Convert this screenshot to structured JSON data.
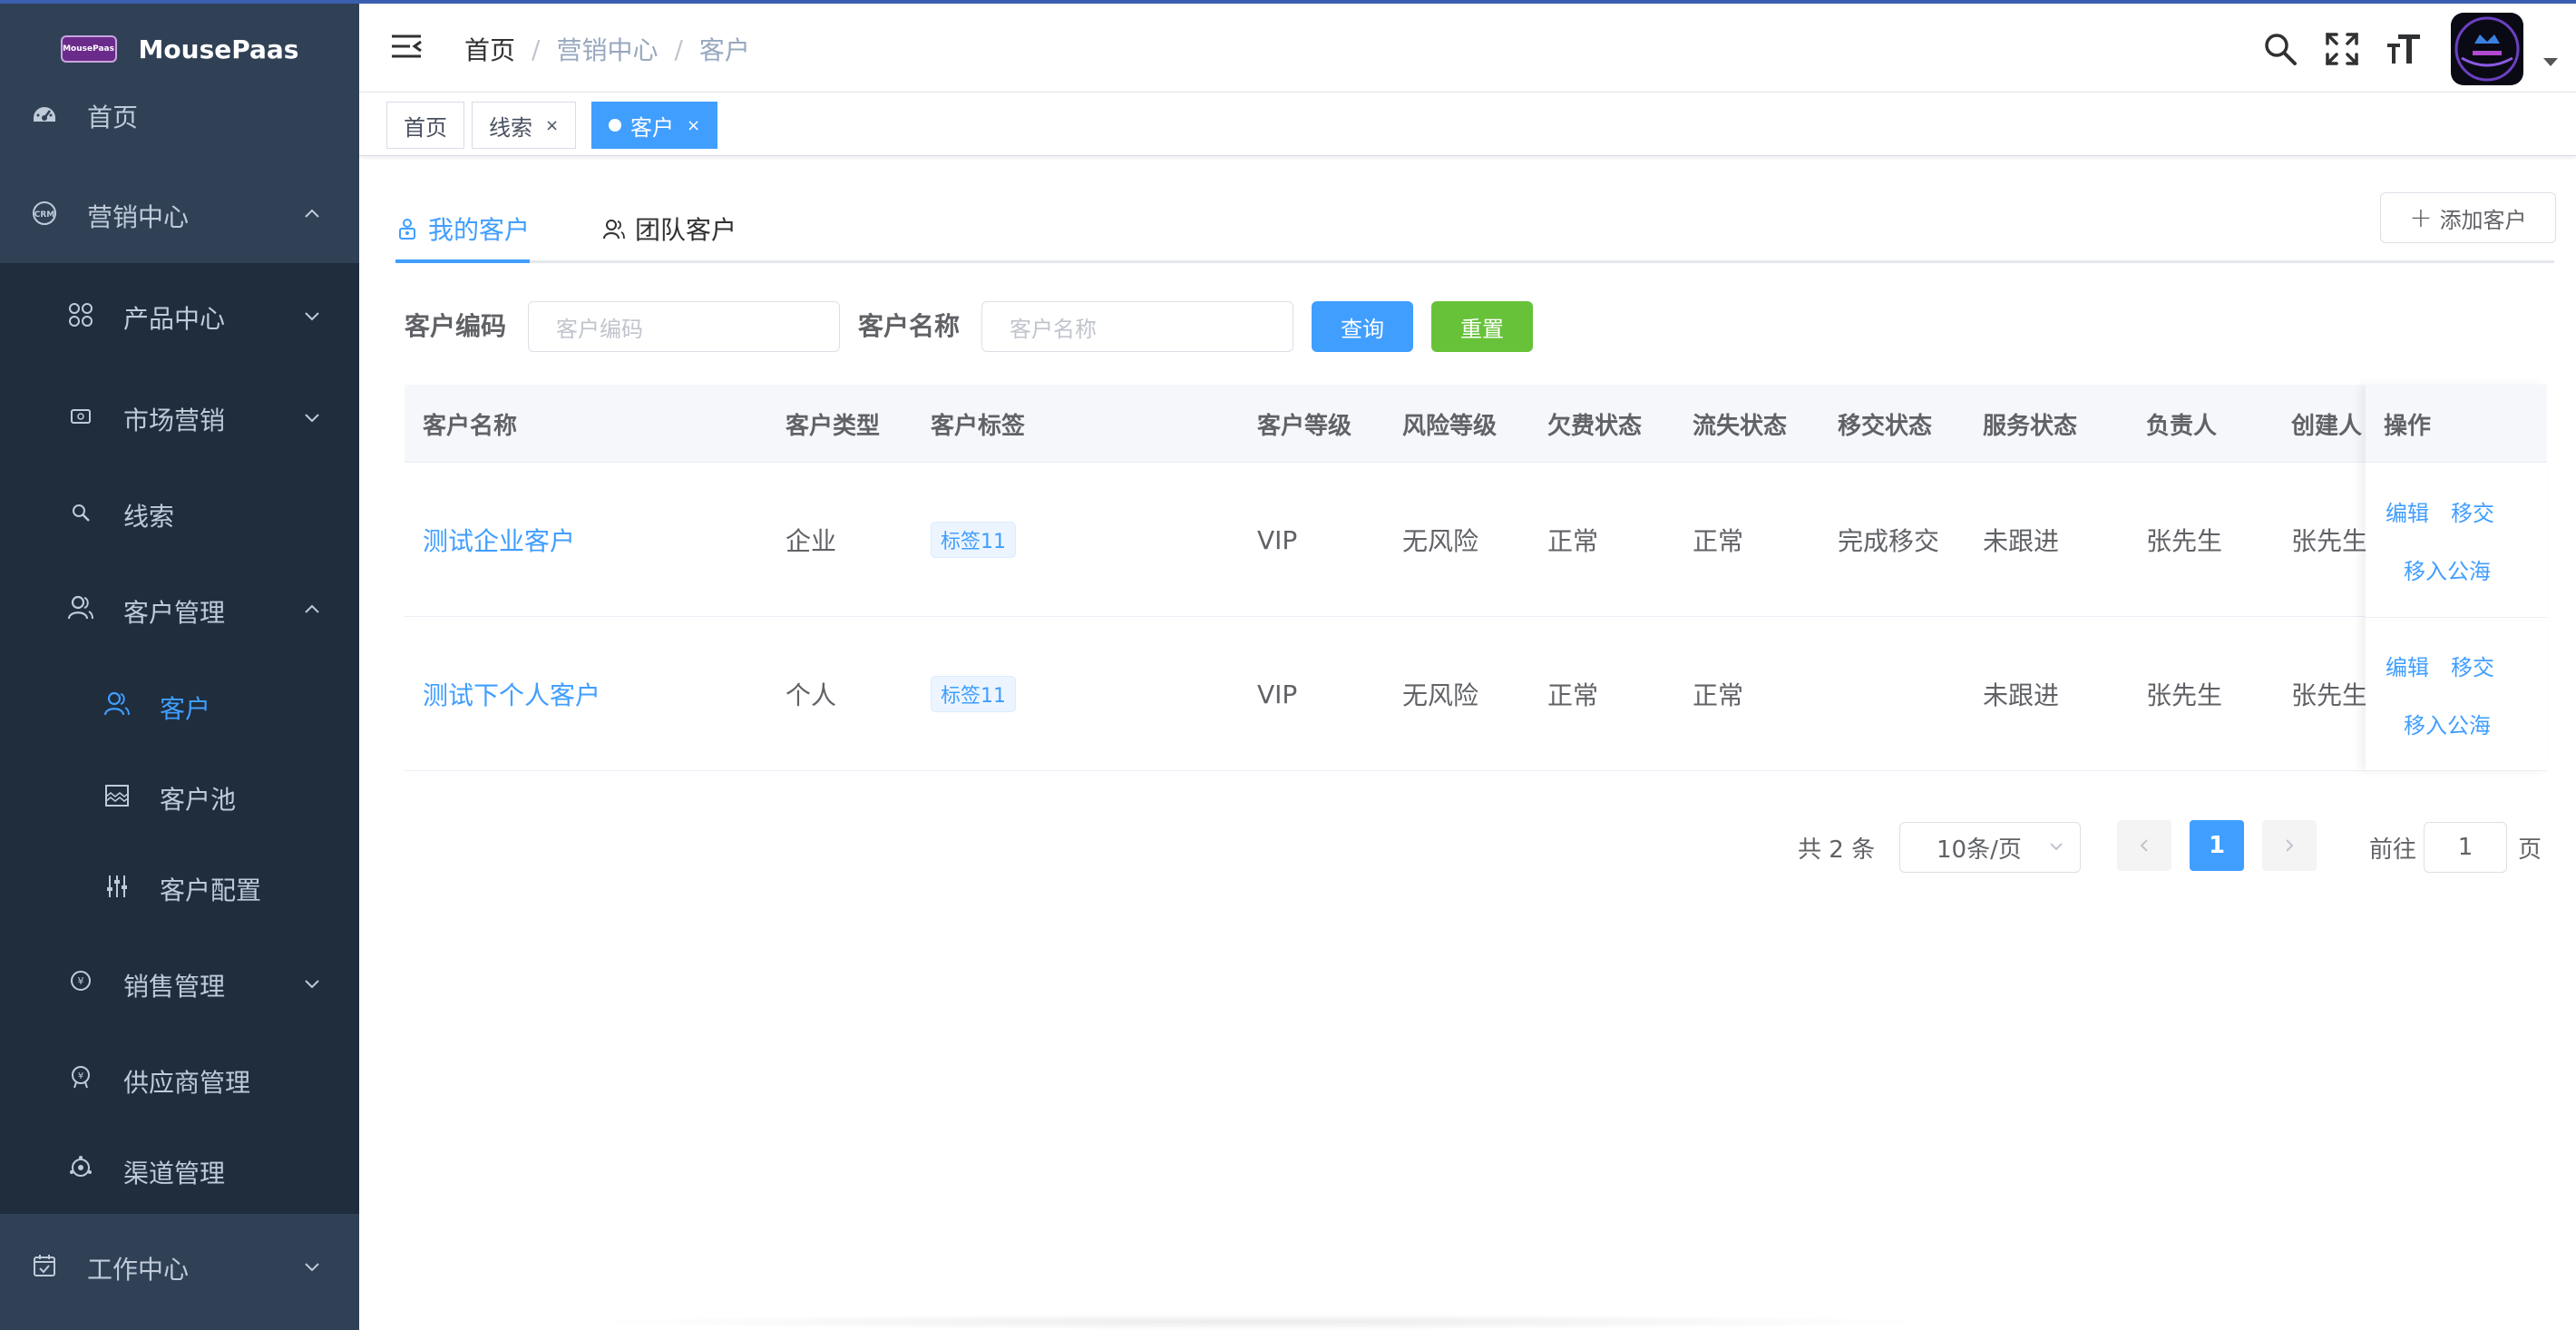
{
  "app": {
    "logo_text": "MousePaas",
    "logo_badge": "MousePaas"
  },
  "sidebar": {
    "items": [
      {
        "label": "首页",
        "icon": "dashboard-icon"
      },
      {
        "label": "营销中心",
        "icon": "crm-icon",
        "expanded": true
      },
      {
        "label": "产品中心",
        "icon": "product-grid-icon"
      },
      {
        "label": "市场营销",
        "icon": "marketing-icon"
      },
      {
        "label": "线索",
        "icon": "clue-search-icon"
      },
      {
        "label": "客户管理",
        "icon": "user-icon",
        "expanded": true
      },
      {
        "label": "客户",
        "icon": "user-icon",
        "active": true
      },
      {
        "label": "客户池",
        "icon": "pool-icon"
      },
      {
        "label": "客户配置",
        "icon": "config-sliders-icon"
      },
      {
        "label": "销售管理",
        "icon": "sales-icon"
      },
      {
        "label": "供应商管理",
        "icon": "supplier-icon"
      },
      {
        "label": "渠道管理",
        "icon": "channel-icon"
      },
      {
        "label": "工作中心",
        "icon": "calendar-check-icon"
      }
    ]
  },
  "header": {
    "breadcrumb": {
      "home": "首页",
      "separator": "/",
      "middle": "营销中心",
      "current": "客户"
    }
  },
  "tagsview": {
    "tags": [
      {
        "label": "首页",
        "closable": false
      },
      {
        "label": "线索",
        "closable": true,
        "close": "×"
      },
      {
        "label": "客户",
        "closable": true,
        "close": "×",
        "active": true
      }
    ]
  },
  "tabs": {
    "mine": "我的客户",
    "team": "团队客户"
  },
  "add_button": {
    "plus": "+",
    "label": "添加客户"
  },
  "search": {
    "code_label": "客户编码",
    "code_placeholder": "客户编码",
    "name_label": "客户名称",
    "name_placeholder": "客户名称",
    "query": "查询",
    "reset": "重置"
  },
  "table": {
    "headers": [
      "客户名称",
      "客户类型",
      "客户标签",
      "客户等级",
      "风险等级",
      "欠费状态",
      "流失状态",
      "移交状态",
      "服务状态",
      "负责人",
      "创建人",
      "操作"
    ],
    "rows": [
      {
        "name": "测试企业客户",
        "type": "企业",
        "tag": "标签11",
        "level": "VIP",
        "risk": "无风险",
        "arrears": "正常",
        "churn": "正常",
        "transfer": "完成移交",
        "service": "未跟进",
        "owner": "张先生",
        "creator": "张先生",
        "ops": [
          "编辑",
          "移交",
          "移入公海"
        ]
      },
      {
        "name": "测试下个人客户",
        "type": "个人",
        "tag": "标签11",
        "level": "VIP",
        "risk": "无风险",
        "arrears": "正常",
        "churn": "正常",
        "transfer": "",
        "service": "未跟进",
        "owner": "张先生",
        "creator": "张先生",
        "ops": [
          "编辑",
          "移交",
          "移入公海"
        ]
      }
    ]
  },
  "pagination": {
    "total": "共 2 条",
    "page_size": "10条/页",
    "current": "1",
    "goto_prefix": "前往",
    "goto_value": "1",
    "goto_suffix": "页"
  },
  "colors": {
    "sidebar_bg": "#304156",
    "sidebar_sub_bg": "#1f2d3d",
    "accent": "#409eff",
    "success": "#67c23a"
  }
}
